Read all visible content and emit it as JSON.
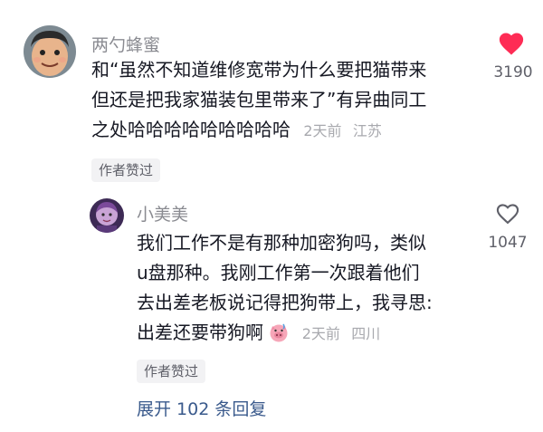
{
  "comments": [
    {
      "username": "两勺蜂蜜",
      "lines": [
        "和“虽然不知道维修宽带为什么要把猫带来",
        "但还是把我家猫装包里带来了”有异曲同工",
        "之处哈哈哈哈哈哈哈哈哈"
      ],
      "time": "2天前",
      "location": "江苏",
      "badge": "作者赞过",
      "like_count": "3190",
      "liked": true,
      "like_icon": "heart-filled-icon"
    },
    {
      "username": "小美美",
      "lines": [
        "我们工作不是有那种加密狗吗，类似",
        "u盘那种。我刚工作第一次跟着他们",
        "去出差老板说记得把狗带上，我寻思:",
        "出差还要带狗啊"
      ],
      "emoji": "pig-emoji-icon",
      "time": "2天前",
      "location": "四川",
      "badge": "作者赞过",
      "like_count": "1047",
      "liked": false,
      "like_icon": "heart-outline-icon"
    }
  ],
  "expand_label": "展开 102 条回复",
  "colors": {
    "heart": "#fe2c55",
    "link": "#3a5a8c"
  }
}
